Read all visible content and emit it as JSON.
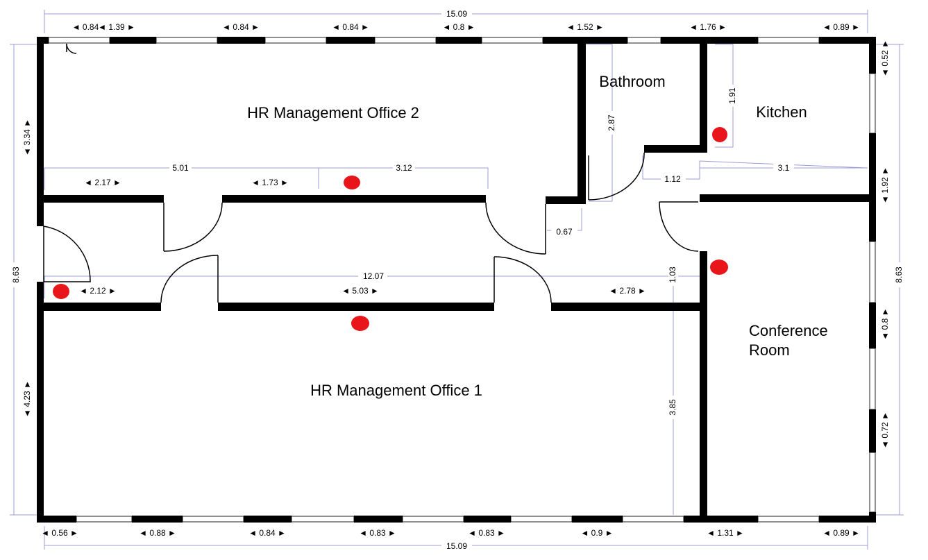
{
  "rooms": {
    "office2": "HR Management Office 2",
    "office1": "HR Management Office 1",
    "bathroom": "Bathroom",
    "kitchen": "Kitchen",
    "conference_line1": "Conference",
    "conference_line2": "Room"
  },
  "dims": {
    "overall_top": "15.09",
    "overall_bottom": "15.09",
    "overall_left": "8.63",
    "overall_right": "8.63",
    "top": [
      "◄ 0.84",
      "◄ 1.39 ►",
      "◄ 0.84 ►",
      "◄ 0.84 ►",
      "◄ 0.8 ►",
      "◄ 1.52 ►",
      "◄ 1.76 ►",
      "◄ 0.89 ►"
    ],
    "bottom": [
      "◄ 0.56 ►",
      "◄ 0.88 ►",
      "◄ 0.84 ►",
      "◄ 0.83 ►",
      "◄ 0.83 ►",
      "◄ 0.9 ►",
      "◄ 1.31 ►",
      "◄ 0.89 ►"
    ],
    "left": [
      "◄ 3.34 ►",
      "◄ 4.23 ►"
    ],
    "right": [
      "◄ 0.52 ►",
      "◄ 1.92 ►",
      "◄ 0.8 ►",
      "◄ 0.72 ►"
    ],
    "office2_width": "5.01",
    "office2_right": "3.12",
    "office2_wall_a": "◄ 2.17 ►",
    "office2_wall_b": "◄ 1.73 ►",
    "corridor_length": "12.07",
    "corridor_wall_a": "◄ 2.12 ►",
    "corridor_wall_b": "◄ 5.03 ►",
    "corridor_wall_c": "◄ 2.78 ►",
    "bathroom_height": "2.87",
    "kitchen_height": "1.91",
    "bath_gap": "1.12",
    "kitchen_width": "3.1",
    "door_gap": "0.67",
    "corridor_depth": "1.03",
    "office1_depth": "3.85"
  },
  "colors": {
    "wall": "#000000",
    "dimension_line": "#9c9cd8",
    "marker": "#e8151a"
  }
}
